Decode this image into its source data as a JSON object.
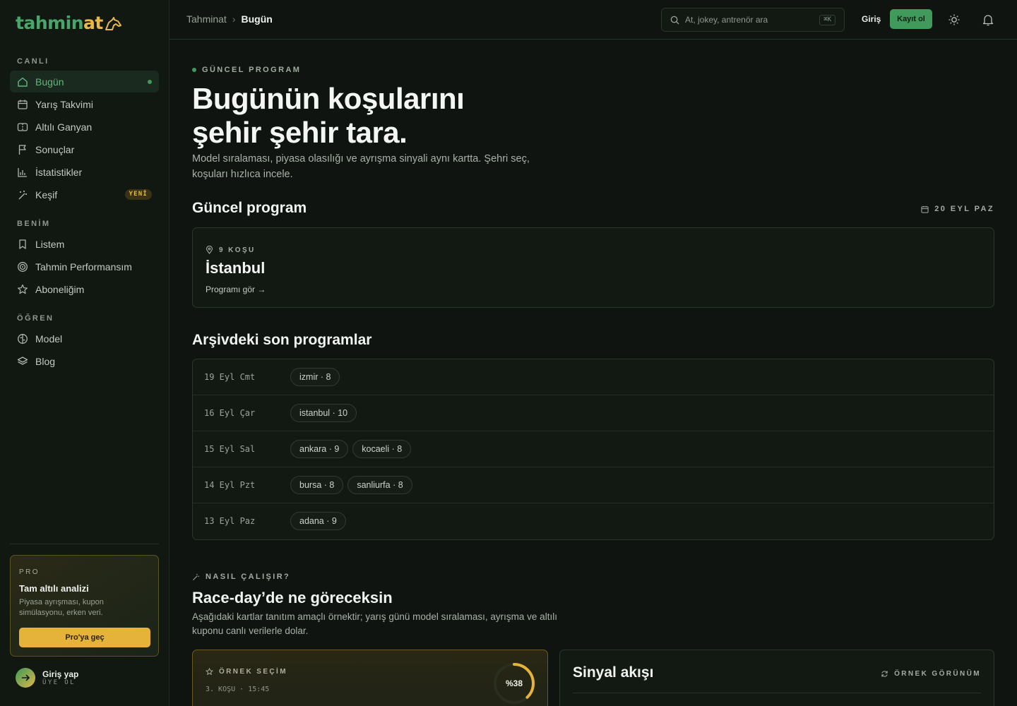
{
  "brand": {
    "part1": "tahmin",
    "part2": "at"
  },
  "sidebar": {
    "sections": [
      {
        "label": "CANLI"
      },
      {
        "label": "BENİM"
      },
      {
        "label": "ÖĞREN"
      }
    ],
    "items": [
      {
        "label": "Bugün",
        "icon": "home-icon",
        "active": true
      },
      {
        "label": "Yarış Takvimi",
        "icon": "calendar-icon"
      },
      {
        "label": "Altılı Ganyan",
        "icon": "ticket-icon"
      },
      {
        "label": "Sonuçlar",
        "icon": "flag-icon"
      },
      {
        "label": "İstatistikler",
        "icon": "bar-chart-icon"
      },
      {
        "label": "Keşif",
        "icon": "sparkle-wand-icon",
        "badge": "YENİ"
      },
      {
        "label": "Listem",
        "icon": "bookmark-icon"
      },
      {
        "label": "Tahmin Performansım",
        "icon": "target-icon"
      },
      {
        "label": "Aboneliğim",
        "icon": "star-icon"
      },
      {
        "label": "Model",
        "icon": "brain-icon"
      },
      {
        "label": "Blog",
        "icon": "layers-icon"
      }
    ],
    "pro": {
      "tag": "PRO",
      "title": "Tam altılı analizi",
      "description": "Piyasa ayrışması, kupon simülasyonu, erken veri.",
      "button": "Pro'ya geç"
    },
    "login": {
      "title": "Giriş yap",
      "subtitle": "ÜYE OL"
    }
  },
  "topbar": {
    "breadcrumb": [
      "Tahminat",
      "Bugün"
    ],
    "search_placeholder": "At, jokey, antrenör ara",
    "search_shortcut": "⌘K",
    "login": "Giriş",
    "signup": "Kayıt ol"
  },
  "hero": {
    "eyebrow": "GÜNCEL PROGRAM",
    "title_line1": "Bugünün koşularını",
    "title_line2": "şehir şehir tara.",
    "subtitle": "Model sıralaması, piyasa olasılığı ve ayrışma sinyali aynı kartta. Şehri seç, koşuları hızlıca incele."
  },
  "current": {
    "heading": "Güncel program",
    "date": "20 EYL PAZ",
    "card": {
      "meta": "9 KOŞU",
      "city": "İstanbul",
      "link": "Programı gör →"
    }
  },
  "archive": {
    "heading": "Arşivdeki son programlar",
    "rows": [
      {
        "date": "19 Eyl Cmt",
        "chips": [
          "izmir · 8"
        ]
      },
      {
        "date": "16 Eyl Çar",
        "chips": [
          "istanbul · 10"
        ]
      },
      {
        "date": "15 Eyl Sal",
        "chips": [
          "ankara · 9",
          "kocaeli · 8"
        ]
      },
      {
        "date": "14 Eyl Pzt",
        "chips": [
          "bursa · 8",
          "sanliurfa · 8"
        ]
      },
      {
        "date": "13 Eyl Paz",
        "chips": [
          "adana · 9"
        ]
      }
    ]
  },
  "how": {
    "eyebrow": "NASIL ÇALIŞIR?",
    "heading": "Race-day’de ne göreceksin",
    "subtitle": "Aşağıdaki kartlar tanıtım amaçlı örnektir; yarış günü model sıralaması, ayrışma ve altılı kuponu canlı verilerle dolar."
  },
  "sample": {
    "label": "ÖRNEK SEÇİM",
    "sub": "3. KOŞU · 15:45",
    "percent_label": "%38",
    "percent_value": 38
  },
  "signal": {
    "title": "Sinyal akışı",
    "tag": "ÖRNEK GÖRÜNÜM"
  },
  "colors": {
    "accent_green": "#3f9a5c",
    "accent_gold": "#e6b33a",
    "background": "#0f1410"
  }
}
